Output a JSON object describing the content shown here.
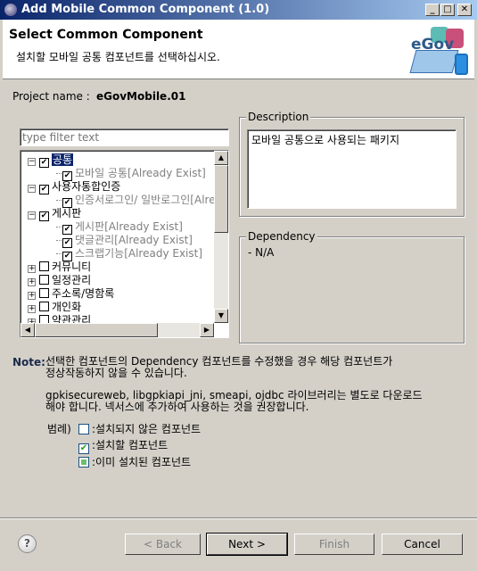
{
  "window": {
    "title": "Add Mobile Common Component (1.0)",
    "minimize": "_",
    "maximize": "□",
    "close": "✕"
  },
  "header": {
    "title": "Select Common Component",
    "subtitle": "설치할 모바일 공통 컴포넌트를 선택하십시오.",
    "logo_text": "eGov"
  },
  "project": {
    "label": "Project name :",
    "value": "eGovMobile.01"
  },
  "filter": {
    "placeholder": "type filter text",
    "value": ""
  },
  "tree": [
    {
      "label": "공통",
      "level": 0,
      "checked": true,
      "expanded": true,
      "selected": true
    },
    {
      "label": "모바일 공통[Already Exist]",
      "level": 1,
      "checked": true,
      "existing": true
    },
    {
      "label": "사용자통합인증",
      "level": 0,
      "checked": true,
      "expanded": true
    },
    {
      "label": "인증서로그인/ 일반로그인[Already Exist]",
      "level": 1,
      "checked": true,
      "existing": true
    },
    {
      "label": "게시판",
      "level": 0,
      "checked": true,
      "expanded": true
    },
    {
      "label": "게시판[Already Exist]",
      "level": 1,
      "checked": true,
      "existing": true
    },
    {
      "label": "댓글관리[Already Exist]",
      "level": 1,
      "checked": true,
      "existing": true
    },
    {
      "label": "스크랩기능[Already Exist]",
      "level": 1,
      "checked": true,
      "existing": true
    },
    {
      "label": "커뮤니티",
      "level": 0,
      "checked": false,
      "expanded": false
    },
    {
      "label": "일정관리",
      "level": 0,
      "checked": false,
      "expanded": false
    },
    {
      "label": "주소록/명함록",
      "level": 0,
      "checked": false,
      "expanded": false
    },
    {
      "label": "개인화",
      "level": 0,
      "checked": false,
      "expanded": false
    },
    {
      "label": "약관관리",
      "level": 0,
      "checked": false,
      "expanded": false
    }
  ],
  "description": {
    "label": "Description",
    "text": "모바일 공통으로 사용되는 패키지"
  },
  "dependency": {
    "label": "Dependency",
    "text": "- N/A"
  },
  "note": {
    "label": "Note:",
    "line1": "선택한 컴포넌트의 Dependency 컴포넌트를 수정했을 경우 해당 컴포넌트가",
    "line2": "정상작동하지 않을 수 있습니다.",
    "line3": "gpkisecureweb, libgpkiapi_jni, smeapi, ojdbc 라이브러리는 별도로 다운로드",
    "line4": "해야 합니다. 넥서스에 추가하여 사용하는 것을 권장합니다."
  },
  "legend": {
    "label": "범례)",
    "items": [
      ":설치되지 않은 컴포넌트",
      ":설치할 컴포넌트",
      ":이미 설치된 컴포넌트"
    ]
  },
  "buttons": {
    "help": "?",
    "back": "< Back",
    "next": "Next >",
    "finish": "Finish",
    "cancel": "Cancel"
  }
}
